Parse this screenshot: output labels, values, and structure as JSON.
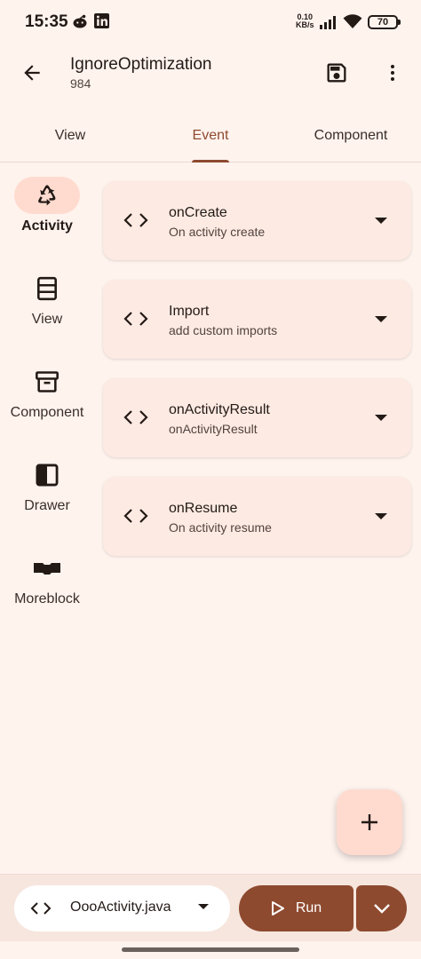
{
  "status_bar": {
    "time": "15:35",
    "net_speed_value": "0.10",
    "net_speed_unit": "KB/s",
    "battery": "70",
    "icons": [
      "reddit-icon",
      "linkedin-icon",
      "signal-icon",
      "wifi-icon",
      "battery-icon"
    ]
  },
  "app_bar": {
    "title": "IgnoreOptimization",
    "subtitle": "984",
    "actions": [
      "back-icon",
      "save-icon",
      "more-vert-icon"
    ]
  },
  "tabs": [
    {
      "label": "View",
      "active": false
    },
    {
      "label": "Event",
      "active": true
    },
    {
      "label": "Component",
      "active": false
    }
  ],
  "rail": [
    {
      "label": "Activity",
      "icon": "recycle-icon",
      "active": true
    },
    {
      "label": "View",
      "icon": "view-stack-icon",
      "active": false
    },
    {
      "label": "Component",
      "icon": "archive-icon",
      "active": false
    },
    {
      "label": "Drawer",
      "icon": "drawer-icon",
      "active": false
    },
    {
      "label": "Moreblock",
      "icon": "moreblock-icon",
      "active": false
    }
  ],
  "events": [
    {
      "title": "onCreate",
      "subtitle": "On activity create"
    },
    {
      "title": "Import",
      "subtitle": "add custom imports"
    },
    {
      "title": "onActivityResult",
      "subtitle": "onActivityResult"
    },
    {
      "title": "onResume",
      "subtitle": "On activity resume"
    }
  ],
  "fab": {
    "icon": "add-icon"
  },
  "bottom_bar": {
    "file_name": "OooActivity.java",
    "run_label": "Run"
  },
  "colors": {
    "background": "#fff3ee",
    "primary": "#8e4a2f",
    "card": "#fdeae3",
    "pill": "#ffdbcf"
  }
}
